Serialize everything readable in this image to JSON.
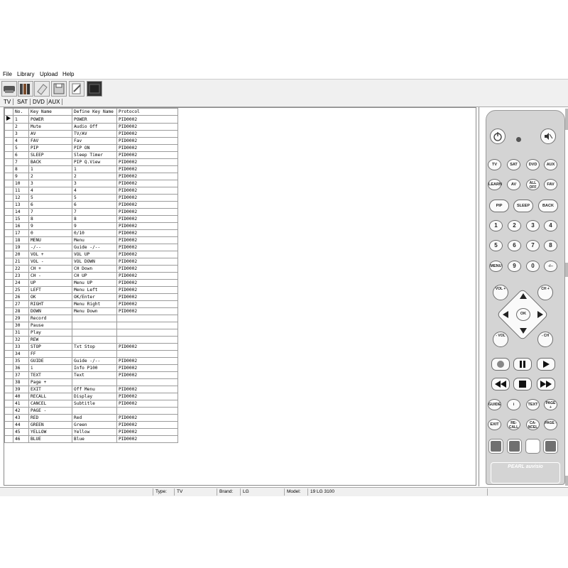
{
  "menu": [
    "File",
    "Library",
    "Upload",
    "Help"
  ],
  "toolbar": {
    "icons": [
      "remote-icon",
      "library-icon",
      "eraser-icon",
      "save-icon",
      "edit-document-icon",
      "lcd-display-icon"
    ]
  },
  "device_tabs": [
    "TV",
    "SAT",
    "DVD",
    "AUX"
  ],
  "table": {
    "columns": [
      "No.",
      "Key Name",
      "Define Key Name",
      "Protocol"
    ],
    "rows": [
      [
        "1",
        "POWER",
        "POWER",
        "PID0002"
      ],
      [
        "2",
        "Mute",
        "Audio Off",
        "PID0002"
      ],
      [
        "3",
        "AV",
        "TV/AV",
        "PID0002"
      ],
      [
        "4",
        "FAV",
        "Fav",
        "PID0002"
      ],
      [
        "5",
        "PIP",
        "PIP ON",
        "PID0002"
      ],
      [
        "6",
        "SLEEP",
        "Sleep Timer",
        "PID0002"
      ],
      [
        "7",
        "BACK",
        "PIP Q.View",
        "PID0002"
      ],
      [
        "8",
        "1",
        "1",
        "PID0002"
      ],
      [
        "9",
        "2",
        "2",
        "PID0002"
      ],
      [
        "10",
        "3",
        "3",
        "PID0002"
      ],
      [
        "11",
        "4",
        "4",
        "PID0002"
      ],
      [
        "12",
        "5",
        "5",
        "PID0002"
      ],
      [
        "13",
        "6",
        "6",
        "PID0002"
      ],
      [
        "14",
        "7",
        "7",
        "PID0002"
      ],
      [
        "15",
        "8",
        "8",
        "PID0002"
      ],
      [
        "16",
        "9",
        "9",
        "PID0002"
      ],
      [
        "17",
        "0",
        "0/10",
        "PID0002"
      ],
      [
        "18",
        "MENU",
        "Menu",
        "PID0002"
      ],
      [
        "19",
        "-/--",
        "Guide -/--",
        "PID0002"
      ],
      [
        "20",
        "VOL +",
        "VOL UP",
        "PID0002"
      ],
      [
        "21",
        "VOL -",
        "VOL DOWN",
        "PID0002"
      ],
      [
        "22",
        "CH +",
        "CH Down",
        "PID0002"
      ],
      [
        "23",
        "CH -",
        "CH UP",
        "PID0002"
      ],
      [
        "24",
        "UP",
        "Menu UP",
        "PID0002"
      ],
      [
        "25",
        "LEFT",
        "Menu Left",
        "PID0002"
      ],
      [
        "26",
        "OK",
        "OK/Enter",
        "PID0002"
      ],
      [
        "27",
        "RIGHT",
        "Menu Right",
        "PID0002"
      ],
      [
        "28",
        "DOWN",
        "Menu Down",
        "PID0002"
      ],
      [
        "29",
        "Record",
        "",
        ""
      ],
      [
        "30",
        "Pause",
        "",
        ""
      ],
      [
        "31",
        "Play",
        "",
        ""
      ],
      [
        "32",
        "REW",
        "",
        ""
      ],
      [
        "33",
        "STOP",
        "Txt Stop",
        "PID0002"
      ],
      [
        "34",
        "FF",
        "",
        ""
      ],
      [
        "35",
        "GUIDE",
        "Guide -/--",
        "PID0002"
      ],
      [
        "36",
        "i",
        "Info P100",
        "PID0002"
      ],
      [
        "37",
        "TEXT",
        "Text",
        "PID0002"
      ],
      [
        "38",
        "Page +",
        "",
        ""
      ],
      [
        "39",
        "EXIT",
        "Off Menu",
        "PID0002"
      ],
      [
        "40",
        "RECALL",
        "Display",
        "PID0002"
      ],
      [
        "41",
        "CANCEL",
        "Subtitle",
        "PID0002"
      ],
      [
        "42",
        "PAGE -",
        "",
        ""
      ],
      [
        "43",
        "RED",
        "Red",
        "PID0002"
      ],
      [
        "44",
        "GREEN",
        "Green",
        "PID0002"
      ],
      [
        "45",
        "YELLOW",
        "Yellow",
        "PID0002"
      ],
      [
        "46",
        "BLUE",
        "Blue",
        "PID0002"
      ]
    ]
  },
  "remote": {
    "device_buttons": [
      "TV",
      "SAT",
      "DVD",
      "AUX"
    ],
    "row2": [
      "LEARN",
      "AV",
      "ALL OFF",
      "FAV"
    ],
    "row3": [
      "PIP",
      "SLEEP",
      "BACK"
    ],
    "digits": [
      "1",
      "2",
      "3",
      "4",
      "5",
      "6",
      "7",
      "8",
      "MENU",
      "9",
      "0",
      "-/--"
    ],
    "vol_plus": "VOL +",
    "ch_plus": "CH +",
    "vol_minus": "- VOL",
    "ch_minus": "- CH",
    "ok": "OK",
    "lower_row1": [
      "GUIDE",
      "i",
      "TEXT",
      "PAGE +"
    ],
    "lower_row2": [
      "EXIT",
      "RE-CALL",
      "CA-NCEL",
      "PAGE -"
    ],
    "brand_mark": "PEARL auvisio",
    "colors": {
      "body": "#d4d4d4",
      "key": "#fafafa",
      "color_keys": [
        "#707070",
        "#707070",
        "#ffffff",
        "#707070"
      ]
    }
  },
  "status": {
    "type_label": "Type:",
    "type_value": "TV",
    "brand_label": "Brand:",
    "brand_value": "LG",
    "model_label": "Model:",
    "model_value": "19 LG 3100"
  }
}
